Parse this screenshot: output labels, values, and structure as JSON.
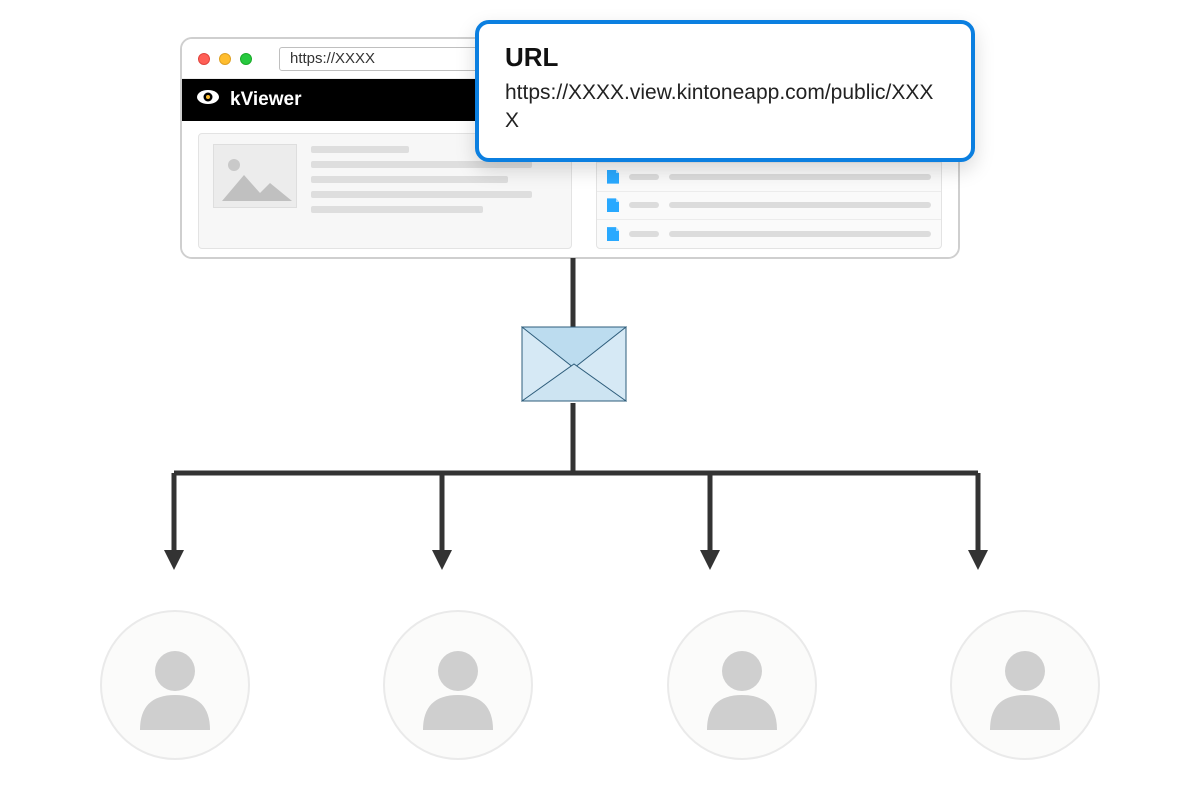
{
  "browser": {
    "address_bar_text": "https://XXXX"
  },
  "app": {
    "name": "kViewer"
  },
  "popover": {
    "title": "URL",
    "url": "https://XXXX.view.kintoneapp.com/public/XXXX"
  },
  "colors": {
    "accent": "#0b7fe0"
  }
}
